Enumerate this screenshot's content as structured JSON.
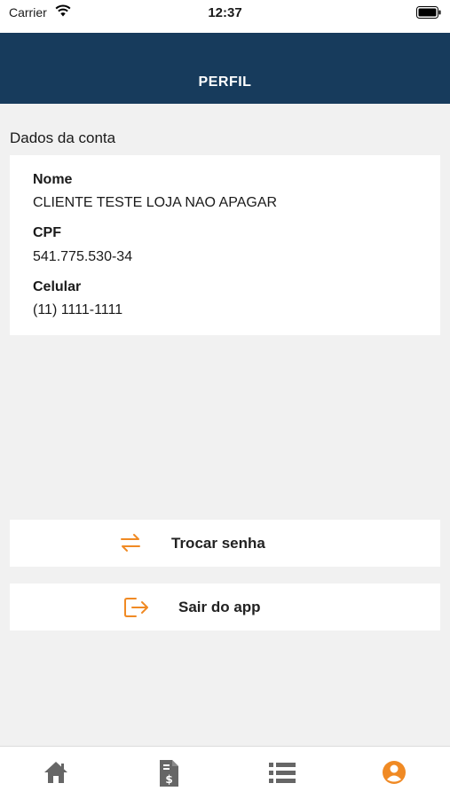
{
  "status_bar": {
    "carrier": "Carrier",
    "time": "12:37"
  },
  "header": {
    "title": "PERFIL"
  },
  "account": {
    "section_title": "Dados da conta",
    "fields": [
      {
        "label": "Nome",
        "value": "CLIENTE TESTE LOJA  NAO APAGAR"
      },
      {
        "label": "CPF",
        "value": "541.775.530-34"
      },
      {
        "label": "Celular",
        "value": "(11) 1111-1111"
      }
    ]
  },
  "actions": {
    "change_password": "Trocar senha",
    "logout": "Sair do app"
  },
  "tabs": [
    {
      "icon": "home-icon"
    },
    {
      "icon": "invoice-icon"
    },
    {
      "icon": "list-icon"
    },
    {
      "icon": "profile-icon",
      "active": true
    }
  ],
  "colors": {
    "header_bg": "#173b5c",
    "accent": "#f08a24",
    "tab_inactive": "#666666",
    "page_bg": "#f1f1f1"
  }
}
